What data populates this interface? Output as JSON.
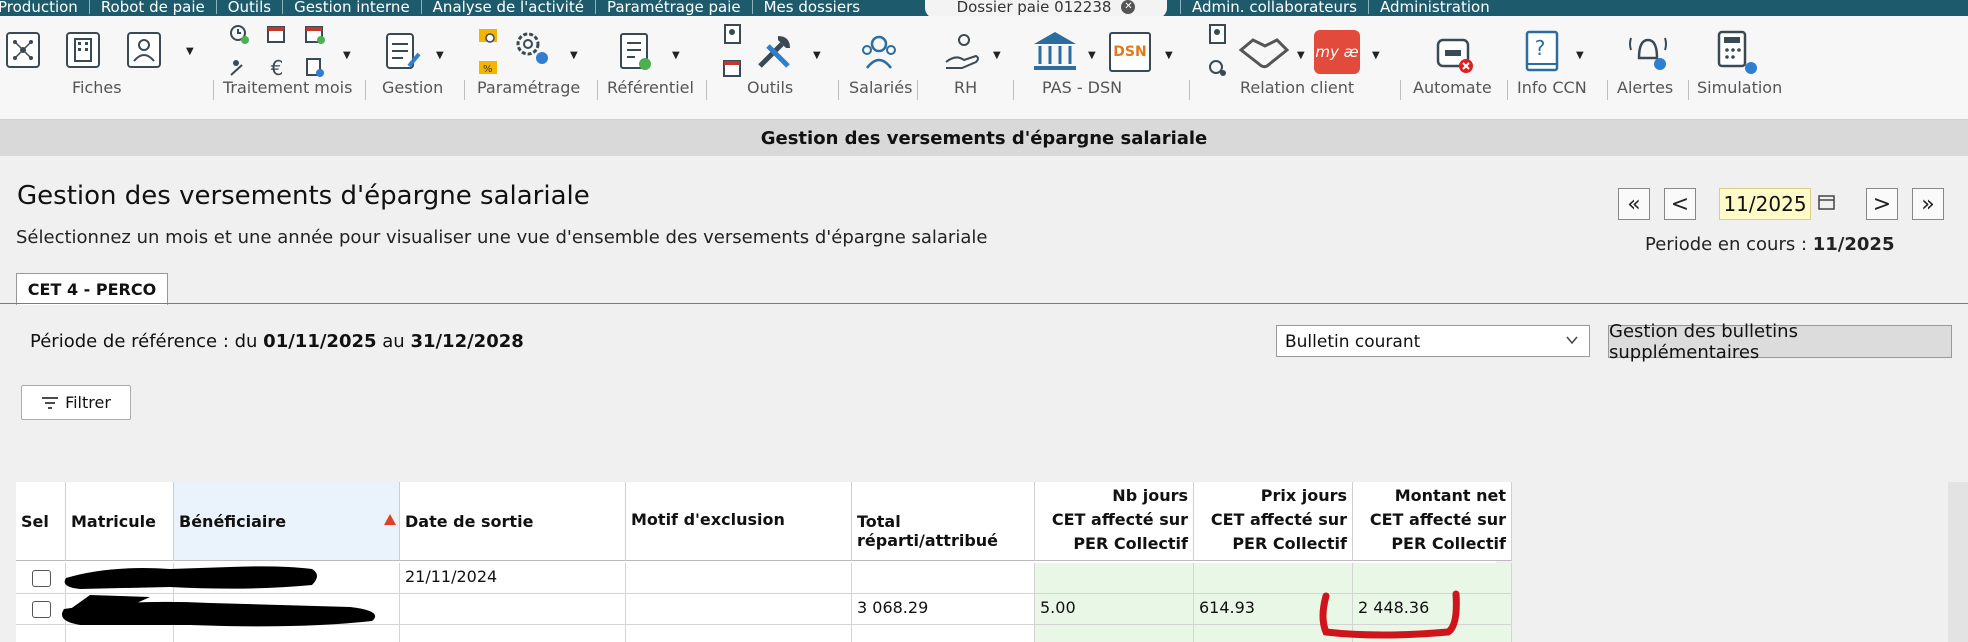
{
  "top_nav": {
    "left_items": [
      "Production",
      "Robot de paie",
      "Outils",
      "Gestion interne",
      "Analyse de l'activité",
      "Paramétrage paie",
      "Mes dossiers"
    ],
    "active_tab": "Dossier paie 012238",
    "right_items": [
      "Admin. collaborateurs",
      "Administration"
    ]
  },
  "ribbon": {
    "groups": [
      "Fiches",
      "Traitement mois",
      "Gestion",
      "Paramétrage",
      "Référentiel",
      "Outils",
      "Salariés",
      "RH",
      "PAS - DSN",
      "Relation client",
      "Automate",
      "Info CCN",
      "Alertes",
      "Simulation"
    ],
    "dsn_icon_text": "DSN",
    "help_icon_text": "?",
    "myae_icon_text": "my æ"
  },
  "title_bar": "Gestion des versements d'épargne salariale",
  "page": {
    "title": "Gestion des versements d'épargne salariale",
    "subtitle": "Sélectionnez un mois et une année pour visualiser une vue d'ensemble des versements d'épargne salariale"
  },
  "period": {
    "value": "11/2025",
    "current_label": "Periode en cours :",
    "current_value": "11/2025",
    "first_icon": "«",
    "prev_icon": "<",
    "next_icon": ">",
    "last_icon": "»"
  },
  "sheet_tab": "CET 4 - PERCO",
  "reference": {
    "label": "Période de référence : du",
    "from": "01/11/2025",
    "to_label": "au",
    "to": "31/12/2028"
  },
  "bulletin_select": {
    "value": "Bulletin courant"
  },
  "bulletin_manage_label": "Gestion des bulletins supplémentaires",
  "filter_label": "Filtrer",
  "table": {
    "headers": {
      "sel": "Sel",
      "matricule": "Matricule",
      "beneficiaire": "Bénéficiaire",
      "date_sortie": "Date de sortie",
      "motif": "Motif d'exclusion",
      "total": "Total réparti/attribué",
      "nb_jours": [
        "Nb jours",
        "CET affecté sur",
        "PER Collectif"
      ],
      "prix_jours": [
        "Prix jours",
        "CET affecté sur",
        "PER Collectif"
      ],
      "montant": [
        "Montant net",
        "CET affecté sur",
        "PER Collectif"
      ]
    },
    "rows": [
      {
        "date_sortie": "21/11/2024",
        "motif": "",
        "total": "",
        "nb_jours": "",
        "prix_jours": "",
        "montant": ""
      },
      {
        "date_sortie": "",
        "motif": "",
        "total": "3 068.29",
        "nb_jours": "5.00",
        "prix_jours": "614.93",
        "montant": "2 448.36"
      }
    ]
  },
  "colors": {
    "top_bar": "#1d5b6c",
    "grid_green": "#e9f8e6",
    "period_highlight": "#fffbc8",
    "annotation_red": "#d0141c",
    "sort_arrow": "#e0412a"
  }
}
